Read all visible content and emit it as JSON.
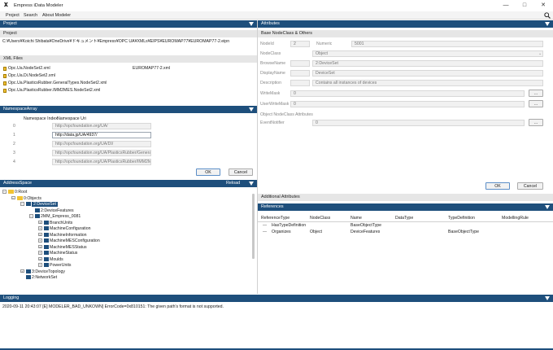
{
  "window": {
    "title": "Empress iData Modeler",
    "controls": [
      "—",
      "□",
      "✕"
    ]
  },
  "menu": {
    "items": [
      "Project",
      "Search",
      "About Modeler"
    ]
  },
  "project": {
    "header": "Project",
    "subheader": "Project",
    "path": "C:¥Users¥Koichi Shibata¥OneDrive¥ドキュメント¥Empress¥OPC UA¥XMLs¥EIPS¥EUROMAP77¥EUROMAP77-2.eipn"
  },
  "xml_files": {
    "header": "XML Files",
    "items": [
      {
        "name": "Opc.Ua.NodeSet2.xml",
        "extra": "EUROMAP77-2.xml"
      },
      {
        "name": "Opc.Ua.Di.NodeSet2.xml",
        "extra": ""
      },
      {
        "name": "Opc.Ua.PlasticsRubber.GeneralTypes.NodeSet2.xml",
        "extra": ""
      },
      {
        "name": "Opc.Ua.PlasticsRubber.IMM2MES.NodeSet2.xml",
        "extra": ""
      }
    ]
  },
  "namespace_array": {
    "header": "NamespaceArray",
    "col_index": "Namespace Index",
    "col_uri": "Namespace Uri",
    "rows": [
      {
        "index": "0",
        "uri": "http://opcfoundation.org/UA/"
      },
      {
        "index": "1",
        "uri": "http://data.jp/UA/4937/"
      },
      {
        "index": "2",
        "uri": "http://opcfoundation.org/UA/DI/"
      },
      {
        "index": "3",
        "uri": "http://opcfoundation.org/UA/PlasticsRubber/Genera"
      },
      {
        "index": "4",
        "uri": "http://opcfoundation.org/UA/PlasticsRubber/IMM2M"
      }
    ],
    "ok": "OK",
    "cancel": "Cancel"
  },
  "address_space": {
    "header": "AddressSpace",
    "reload": "Reload",
    "nodes": [
      {
        "label": "0:Root",
        "depth": 0,
        "type": "folder",
        "toggle": "−"
      },
      {
        "label": "0:Objects",
        "depth": 1,
        "type": "folder",
        "toggle": "−"
      },
      {
        "label": "2:DeviceSet",
        "depth": 2,
        "type": "obj",
        "toggle": "−",
        "selected": true
      },
      {
        "label": "2:DeviceFeatures",
        "depth": 3,
        "type": "obj",
        "toggle": ""
      },
      {
        "label": "2MM_Empress_0081",
        "depth": 3,
        "type": "obj",
        "toggle": "−"
      },
      {
        "label": "BranchUnits",
        "depth": 4,
        "type": "obj",
        "toggle": "+"
      },
      {
        "label": "MachineConfiguration",
        "depth": 4,
        "type": "obj",
        "toggle": "+"
      },
      {
        "label": "MachineInformation",
        "depth": 4,
        "type": "obj",
        "toggle": "+"
      },
      {
        "label": "MachineMESConfiguration",
        "depth": 4,
        "type": "obj",
        "toggle": "+"
      },
      {
        "label": "MachineMESStatus",
        "depth": 4,
        "type": "obj",
        "toggle": "+"
      },
      {
        "label": "MachineStatus",
        "depth": 4,
        "type": "obj",
        "toggle": "+"
      },
      {
        "label": "Moulds",
        "depth": 4,
        "type": "obj",
        "toggle": "+"
      },
      {
        "label": "PowerUnits",
        "depth": 4,
        "type": "obj",
        "toggle": "+"
      },
      {
        "label": "3:DeviceTopology",
        "depth": 2,
        "type": "obj",
        "toggle": "+"
      },
      {
        "label": "2:NetworkSet",
        "depth": 2,
        "type": "obj",
        "toggle": ""
      }
    ]
  },
  "attributes": {
    "header": "Attributes",
    "subheader": "Base NodeClass & Others",
    "nodeid_label": "NodeId",
    "nodeid_ns": "2",
    "numeric_label": "Numeric",
    "nodeid_value": "5001",
    "nodeclass_label": "NodeClass",
    "nodeclass_value": "Object",
    "browsename_label": "BrowseName",
    "browsename_value": "2:DeviceSet",
    "displayname_label": "DisplayName",
    "displayname_value": "DeviceSet",
    "description_label": "Description",
    "description_value": "Contains all instances of devices",
    "writemask_label": "WriteMask",
    "writemask_value": "0",
    "userwritemask_label": "UserWriteMask",
    "userwritemask_value": "0",
    "object_nodeclass_label": "Object NodeClass Attributes",
    "eventnotifier_label": "EventNotifier",
    "eventnotifier_value": "0",
    "ellipsis": "...",
    "ok": "OK",
    "cancel": "Cancel"
  },
  "additional_attributes": {
    "header": "Additional Attributes"
  },
  "references": {
    "header": "References",
    "columns": [
      "ReferenceType",
      "NodeClass",
      "Name",
      "DataType",
      "TypeDefinition",
      "ModellingRule"
    ],
    "rows": [
      {
        "reftype": "HasTypeDefinition",
        "nodeclass": "",
        "name": "BaseObjectType",
        "datatype": "",
        "typedef": "",
        "rule": ""
      },
      {
        "reftype": "Organizes",
        "nodeclass": "Object",
        "name": "DeviceFeatures",
        "datatype": "",
        "typedef": "BaseObjectType",
        "rule": ""
      }
    ]
  },
  "logging": {
    "header": "Logging",
    "line": "2020-09-11 20:43:07 [E] MODELER_BAD_UNKOWN] ErrorCode=0x810151: The given path's format is not supported."
  },
  "colors": {
    "accent": "#1e4f7c",
    "folder": "#f1c232"
  }
}
